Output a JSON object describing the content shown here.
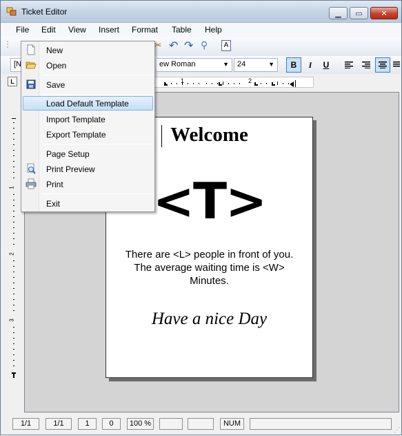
{
  "window": {
    "title": "Ticket Editor"
  },
  "menubar": {
    "items": [
      "File",
      "Edit",
      "View",
      "Insert",
      "Format",
      "Table",
      "Help"
    ]
  },
  "toolbar": {
    "style_combo": "[N",
    "font_combo": "ew Roman",
    "size_combo": "24"
  },
  "format_buttons": {
    "bold": "B",
    "italic": "I",
    "underline": "U"
  },
  "ruler": {
    "corner": "L",
    "h_labels": [
      "1",
      "2"
    ],
    "v_labels": [
      "1",
      "2",
      "3"
    ]
  },
  "file_menu": {
    "items": [
      {
        "label": "New",
        "icon": "new-document-icon"
      },
      {
        "label": "Open",
        "icon": "folder-open-icon"
      },
      {
        "label": "Save",
        "icon": "floppy-disk-icon"
      },
      {
        "label": "Load Default Template",
        "icon": ""
      },
      {
        "label": "Import Template",
        "icon": ""
      },
      {
        "label": "Export Template",
        "icon": ""
      },
      {
        "label": "Page Setup",
        "icon": ""
      },
      {
        "label": "Print Preview",
        "icon": "print-preview-icon"
      },
      {
        "label": "Print",
        "icon": "printer-icon"
      },
      {
        "label": "Exit",
        "icon": ""
      }
    ],
    "highlighted": "Load Default Template"
  },
  "ticket": {
    "heading": "Welcome",
    "number_placeholder": "<T>",
    "message_line1": "There are <L> people in front of you.",
    "message_line2": "The average waiting time  is <W>",
    "message_line3": "Minutes.",
    "farewell": "Have a nice Day"
  },
  "status": {
    "page": "1/1",
    "section": "1/1",
    "line": "1",
    "column": "0",
    "zoom": "100 %",
    "empty1": "",
    "empty2": "",
    "num": "NUM",
    "empty3": ""
  },
  "colors": {
    "menu_highlight": "#c5dff7",
    "active_button": "#c9e0f7",
    "close_button": "#c7432e"
  }
}
